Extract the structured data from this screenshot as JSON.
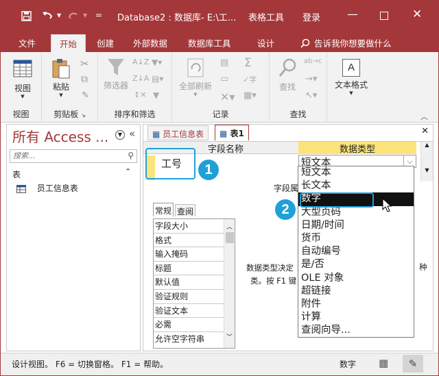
{
  "title": {
    "doc": "Database2 : 数据库- E:\\工...",
    "context_tab": "表格工具",
    "login": "登录"
  },
  "ribbon_tabs": [
    "文件",
    "开始",
    "创建",
    "外部数据",
    "数据库工具",
    "设计"
  ],
  "tell_me": "告诉我你想要做什么",
  "ribbon": {
    "view": "视图",
    "paste": "粘贴",
    "filter": "筛选器",
    "refresh": "全部刷新",
    "find": "查找",
    "text_format": "文本格式",
    "groups": {
      "views": "视图",
      "clipboard": "剪贴板",
      "sortfilter": "排序和筛选",
      "records": "记录",
      "find": "查找"
    }
  },
  "nav": {
    "title": "所有 Access ...",
    "search_placeholder": "搜索...",
    "section": "表",
    "items": [
      "员工信息表"
    ]
  },
  "doc_tabs": [
    "员工信息表",
    "表1"
  ],
  "grid": {
    "col_field": "字段名称",
    "col_type": "数据类型",
    "row1_field": "工号",
    "row1_type": "短文本"
  },
  "dropdown": [
    "短文本",
    "长文本",
    "数字",
    "大型页码",
    "日期/时间",
    "货币",
    "自动编号",
    "是/否",
    "OLE 对象",
    "超链接",
    "附件",
    "计算",
    "查阅向导..."
  ],
  "selected_index": 2,
  "field_props_label": "字段属",
  "prop_tabs": [
    "常规",
    "查阅"
  ],
  "props": [
    "字段大小",
    "格式",
    "输入掩码",
    "标题",
    "默认值",
    "验证规则",
    "验证文本",
    "必需",
    "允许空字符串"
  ],
  "help": {
    "line1": "数据类型决定",
    "line1_end": "种",
    "line2": "类。按 F1 键"
  },
  "badges": [
    "1",
    "2"
  ],
  "status": {
    "left": "设计视图。 F6 = 切换窗格。 F1 = 帮助。",
    "right": "数字"
  },
  "colors": {
    "accent": "#a4373a",
    "callout": "#1fa1d8",
    "header_yellow": "#fbe47a"
  }
}
